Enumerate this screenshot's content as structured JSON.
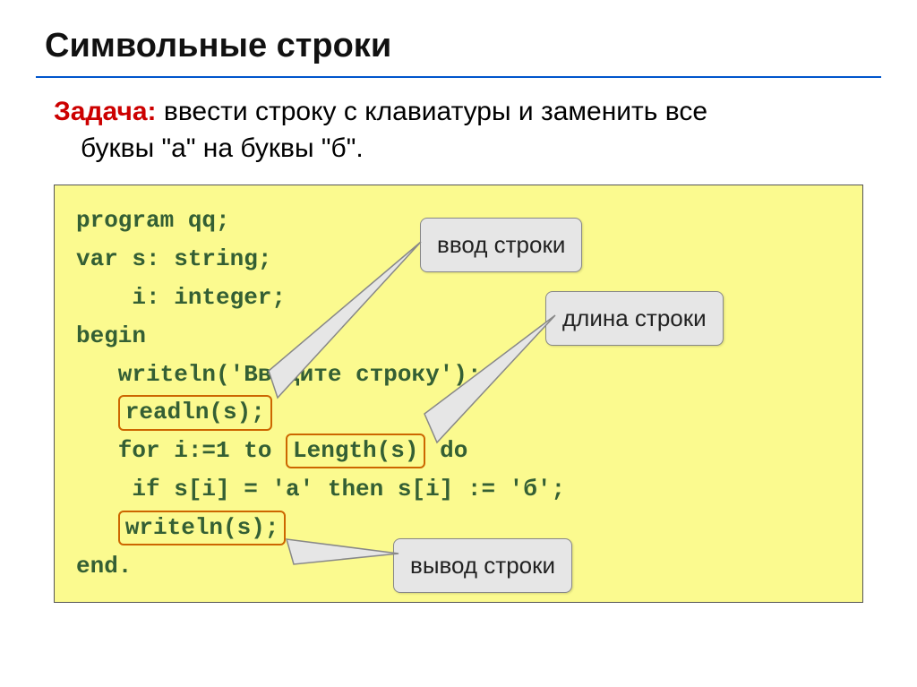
{
  "title": "Символьные строки",
  "task": {
    "label": "Задача:",
    "text_line1": " ввести строку с клавиатуры и заменить все",
    "text_line2": "буквы \"а\" на буквы \"б\"."
  },
  "code": {
    "l1": "program qq;",
    "l2": "var s: string;",
    "l3": "    i: integer;",
    "l4": "begin",
    "l5": "   writeln('Введите строку');",
    "l6_hl": "readln(s);",
    "l7_pre": "   for i:=1 to ",
    "l7_hl": "Length(s)",
    "l7_post": " do",
    "l8": "    if s[i] = 'а' then s[i] := 'б';",
    "l9_hl": "writeln(s);",
    "l10": "end."
  },
  "callouts": {
    "input": "ввод строки",
    "length": "длина строки",
    "output": "вывод строки"
  }
}
